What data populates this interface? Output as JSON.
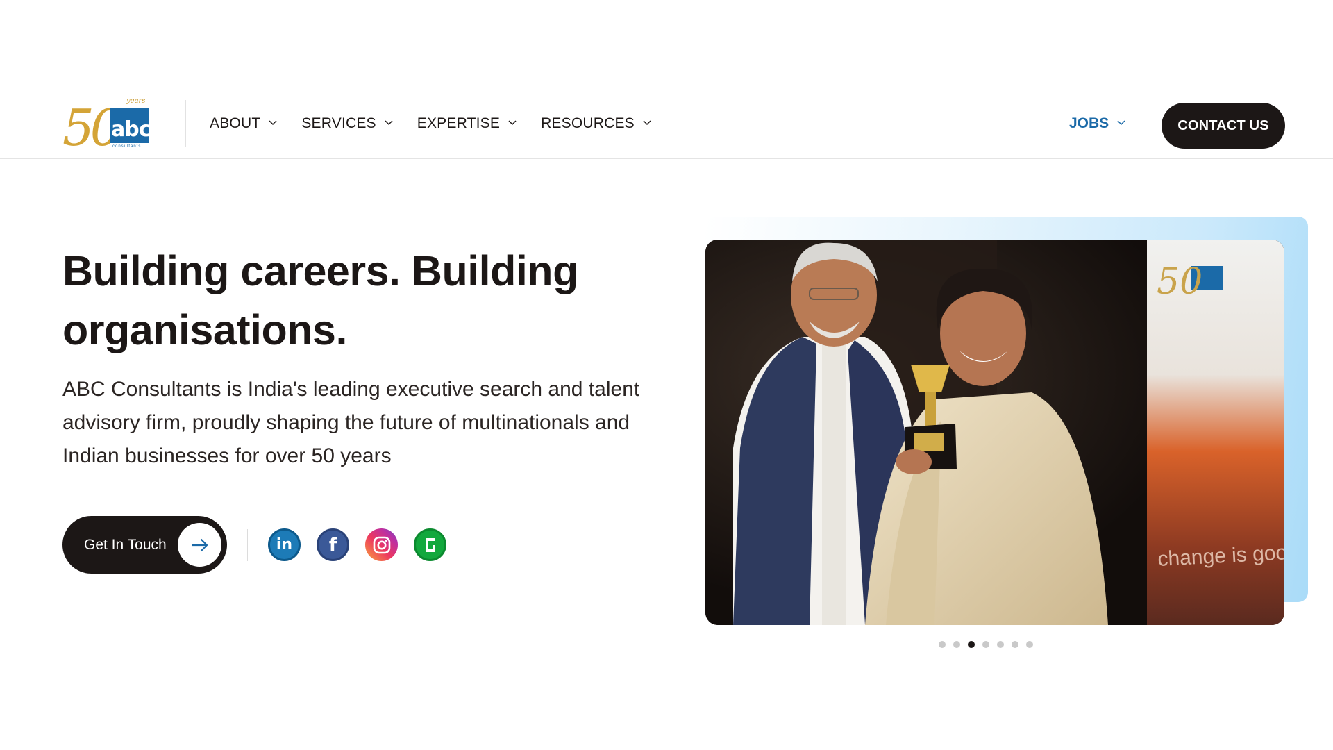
{
  "brand": {
    "logo_number": "50",
    "logo_years": "years",
    "logo_name": "abc",
    "logo_sub": "consultants"
  },
  "nav": {
    "items": [
      {
        "label": "ABOUT"
      },
      {
        "label": "SERVICES"
      },
      {
        "label": "EXPERTISE"
      },
      {
        "label": "RESOURCES"
      }
    ],
    "jobs_label": "JOBS",
    "contact_label": "CONTACT US"
  },
  "hero": {
    "title": "Building careers. Building organisations.",
    "description": "ABC Consultants is India's leading executive search and talent advisory firm, proudly shaping the future of multinationals and Indian businesses for over 50 years",
    "cta_label": "Get In Touch",
    "image_banner_text": "change is good"
  },
  "social": [
    {
      "icon": "linkedin-icon",
      "glyph": "in"
    },
    {
      "icon": "facebook-icon",
      "glyph": "f"
    },
    {
      "icon": "instagram-icon",
      "glyph": ""
    },
    {
      "icon": "glassdoor-icon",
      "glyph": ""
    }
  ],
  "carousel": {
    "total_slides": 7,
    "active_index": 2
  },
  "colors": {
    "primary_dark": "#1c1716",
    "brand_blue": "#1b6aa8",
    "brand_gold": "#d4a437"
  }
}
